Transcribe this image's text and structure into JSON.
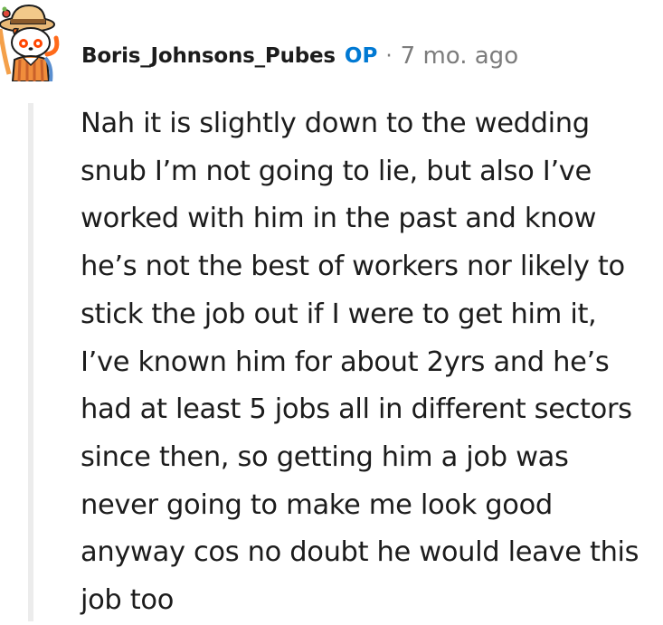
{
  "comment": {
    "author": "Boris_Johnsons_Pubes",
    "op_label": "OP",
    "separator": "·",
    "timestamp": "7 mo. ago",
    "avatar_icon": "snoo-avatar-icon",
    "body": "Nah it is slightly down to the wedding snub I’m not going to lie, but also I’ve worked with him in the past and know he’s not the best of workers nor likely to stick the job out if I were to get him it, I’ve known him for about 2yrs and he’s had at least 5 jobs all in different sectors since then, so getting him a job was never going to make me look good anyway cos no doubt he would leave this job too"
  },
  "colors": {
    "op": "#0079d3",
    "meta": "#7c7c7c",
    "text": "#1c1c1c",
    "thread_line": "#ececec"
  }
}
